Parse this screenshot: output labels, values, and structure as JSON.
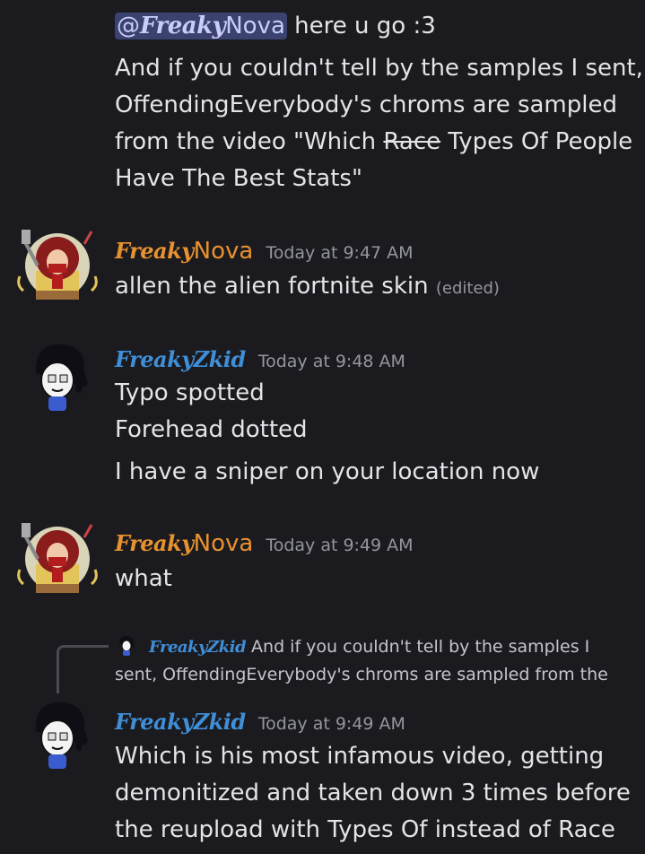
{
  "message1": {
    "mention": "@",
    "mention_script": "Freaky",
    "mention_name": "Nova",
    "line1_rest": " here u go :3",
    "line2": "And if you couldn't tell by the samples I sent,",
    "line3": "OffendingEverybody's chroms are sampled",
    "line4_a": "from the video \"Which ",
    "line4_strike": "Race",
    "line4_b": " Types Of People",
    "line5": "Have The Best Stats\""
  },
  "message2": {
    "author_script": "Freaky",
    "author_name": "Nova",
    "timestamp": "Today at 9:47 AM",
    "text": "allen the alien fortnite skin",
    "edited": "(edited)"
  },
  "message3": {
    "author": "FreakyZkid",
    "timestamp": "Today at 9:48 AM",
    "line1": "Typo spotted",
    "line2": "Forehead dotted",
    "line3": "I have a sniper on your location now"
  },
  "message4": {
    "author_script": "Freaky",
    "author_name": "Nova",
    "timestamp": "Today at 9:49 AM",
    "text": "what"
  },
  "reply_preview": {
    "author": "FreakyZkid",
    "line1": "And if you couldn't tell by the samples I",
    "line2": "sent, OffendingEverybody's chroms are sampled from the"
  },
  "message5": {
    "author": "FreakyZkid",
    "timestamp": "Today at 9:49 AM",
    "line1": "Which is his most infamous video, getting",
    "line2": "demonitized and taken down 3 times before",
    "line3": "the reupload with Types Of instead of Race"
  },
  "colors": {
    "background": "#1b1b1f",
    "nova_name": "#e8912f",
    "zkid_name": "#3f8fd8",
    "mention_bg": "#3c4270",
    "timestamp": "#94969e"
  }
}
